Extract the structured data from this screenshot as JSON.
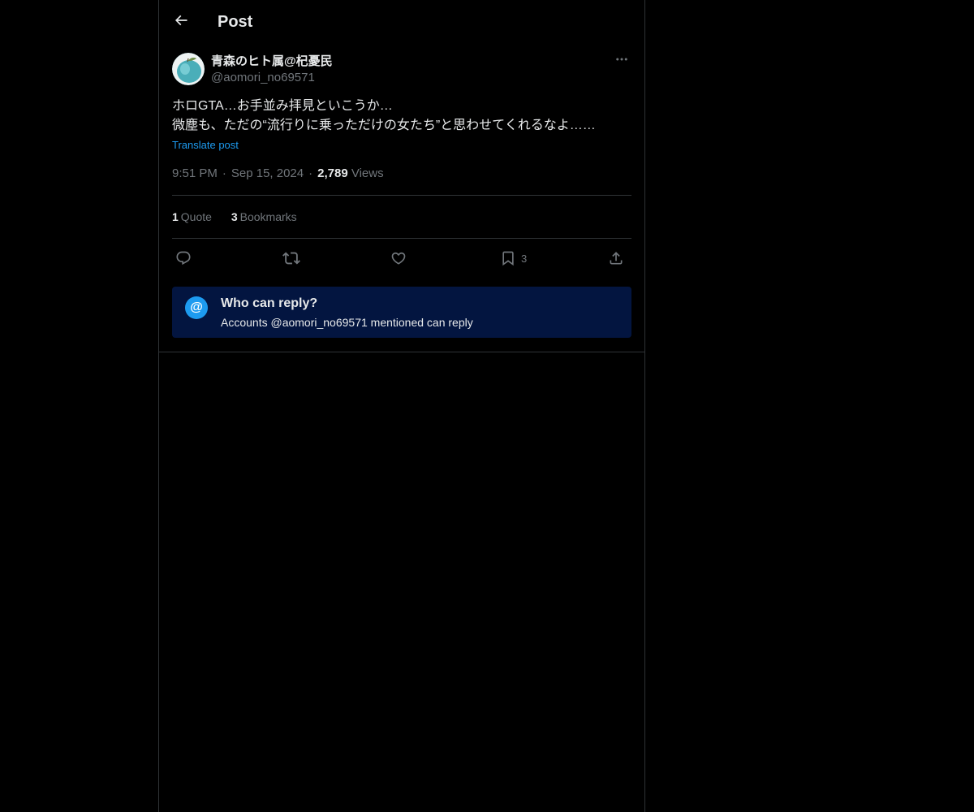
{
  "header": {
    "title": "Post",
    "back_icon": "arrow-left-icon"
  },
  "author": {
    "display_name": "青森のヒト属@杞憂民",
    "handle": "@aomori_no69571",
    "more_icon": "more-horizontal-icon"
  },
  "post": {
    "lines": [
      "ホロGTA…お手並み拝見といこうか…",
      "微塵も、ただの“流行りに乗っただけの女たち”と思わせてくれるなよ……"
    ],
    "translate_label": "Translate post"
  },
  "meta": {
    "time": "9:51 PM",
    "date": "Sep 15, 2024",
    "views_count": "2,789",
    "views_label": "Views",
    "separator": "·"
  },
  "stats": {
    "quote_count": "1",
    "quote_label": "Quote",
    "bookmark_count": "3",
    "bookmark_label": "Bookmarks"
  },
  "actions": {
    "reply_icon": "reply-icon",
    "repost_icon": "repost-icon",
    "like_icon": "like-icon",
    "bookmark_icon": "bookmark-icon",
    "bookmark_count": "3",
    "share_icon": "share-icon"
  },
  "reply_restriction": {
    "badge": "@",
    "title": "Who can reply?",
    "subtitle": "Accounts @aomori_no69571 mentioned can reply"
  },
  "colors": {
    "background": "#000000",
    "text_primary": "#e7e9ea",
    "text_secondary": "#71767b",
    "accent": "#1d9bf0",
    "border": "#2f3336",
    "reply_box_bg": "#031540"
  }
}
